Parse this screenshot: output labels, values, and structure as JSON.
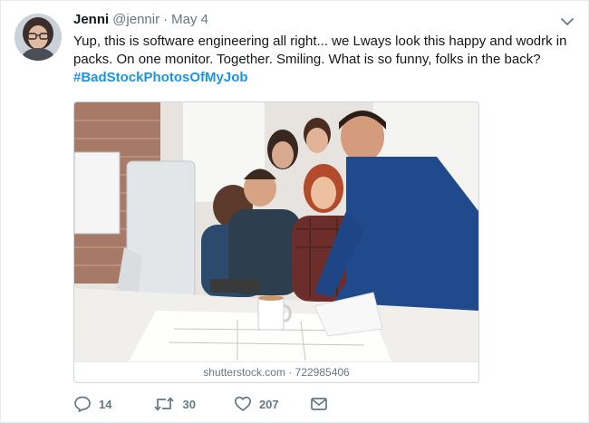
{
  "tweet": {
    "author_name": "Jenni",
    "handle": "@jennir",
    "separator": "·",
    "date": "May 4",
    "text_line1": "Yup, this is software engineering all right... we Lways look this happy and wodrk in",
    "text_line2": "packs. On one monitor. Together. Smiling.  What is so funny, folks in the back?",
    "hashtag": "#BadStockPhotosOfMyJob"
  },
  "media": {
    "attribution_site": "shutterstock.com",
    "attribution_separator": "·",
    "attribution_id": "722985406"
  },
  "actions": {
    "replies": "14",
    "retweets": "30",
    "likes": "207"
  },
  "colors": {
    "link": "#1b95e0",
    "muted": "#657786",
    "text": "#14171a"
  },
  "icons": {
    "reply": "reply-icon",
    "retweet": "retweet-icon",
    "like": "heart-icon",
    "dm": "envelope-icon",
    "menu": "chevron-down-icon"
  }
}
